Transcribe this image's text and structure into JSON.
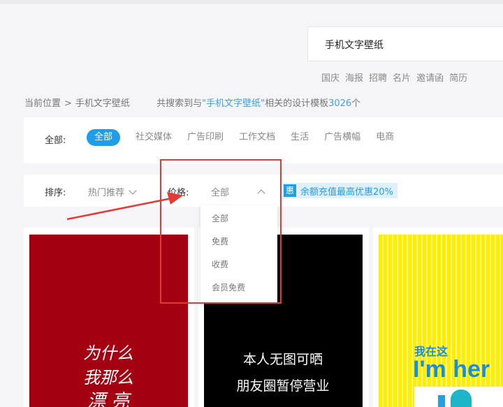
{
  "search": {
    "query": "手机文字壁纸"
  },
  "hot_tags": [
    "国庆",
    "海报",
    "招聘",
    "名片",
    "邀请函",
    "简历"
  ],
  "breadcrumb": {
    "prefix": "当前位置",
    "separator": ">",
    "current": "手机文字壁纸",
    "result_before": "共搜索到与",
    "result_keyword": "\"手机文字壁纸\"",
    "result_middle": "相关的设计模板",
    "result_count": "3026",
    "result_after": "个"
  },
  "categories": {
    "label": "全部:",
    "items": [
      "全部",
      "社交媒体",
      "广告印刷",
      "工作文档",
      "生活",
      "广告横幅",
      "电商"
    ],
    "active": "全部"
  },
  "sort": {
    "label": "排序:",
    "value": "热门推荐"
  },
  "price": {
    "label": "价格:",
    "value": "全部",
    "options": [
      "全部",
      "免费",
      "收费",
      "会员免费"
    ]
  },
  "promo": {
    "icon_text": "惠",
    "text": "余额充值最高优惠20%"
  },
  "cards": [
    {
      "lines": [
        "为什么",
        "我那么",
        "漂  亮"
      ],
      "bg_color": "#a30012"
    },
    {
      "lines": [
        "本人无图可晒",
        "朋友圈暂停营业"
      ],
      "bg_color": "#000000"
    },
    {
      "small_text": "我在这",
      "big_text": "I'm her",
      "bg_color": "#ffee00"
    }
  ],
  "colors": {
    "accent": "#1f9de8",
    "annotation": "#e53935"
  }
}
